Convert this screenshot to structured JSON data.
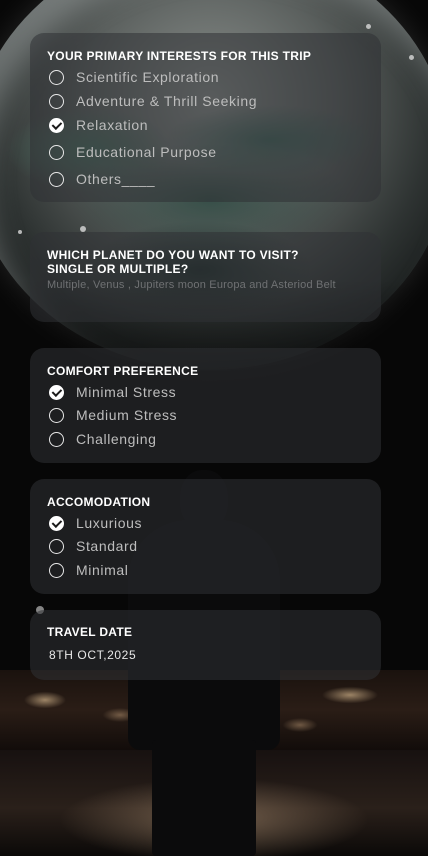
{
  "interests": {
    "title": "YOUR PRIMARY INTERESTS FOR THIS TRIP",
    "options": [
      {
        "label": "Scientific Exploration",
        "checked": false
      },
      {
        "label": "Adventure & Thrill Seeking",
        "checked": false
      },
      {
        "label": "Relaxation",
        "checked": true
      },
      {
        "label": "Educational Purpose",
        "checked": false
      },
      {
        "label": "Others____",
        "checked": false
      }
    ]
  },
  "planet": {
    "title_line1": "WHICH PLANET DO YOU WANT TO VISIT?",
    "title_line2": "SINGLE OR MULTIPLE?",
    "answer": "Multiple, Venus , Jupiters moon Europa and Asteriod Belt"
  },
  "comfort": {
    "title": "COMFORT PREFERENCE",
    "options": [
      {
        "label": "Minimal Stress",
        "checked": true
      },
      {
        "label": "Medium Stress",
        "checked": false
      },
      {
        "label": "Challenging",
        "checked": false
      }
    ]
  },
  "accommodation": {
    "title": "ACCOMODATION",
    "options": [
      {
        "label": "Luxurious",
        "checked": true
      },
      {
        "label": "Standard",
        "checked": false
      },
      {
        "label": "Minimal",
        "checked": false
      }
    ]
  },
  "travel": {
    "title": "TRAVEL DATE",
    "value": "8TH OCT,2025"
  },
  "colors": {
    "card_bg": "#303234",
    "text_primary": "#ffffff",
    "text_option": "#bdbdbd",
    "text_muted": "#6f7173"
  }
}
